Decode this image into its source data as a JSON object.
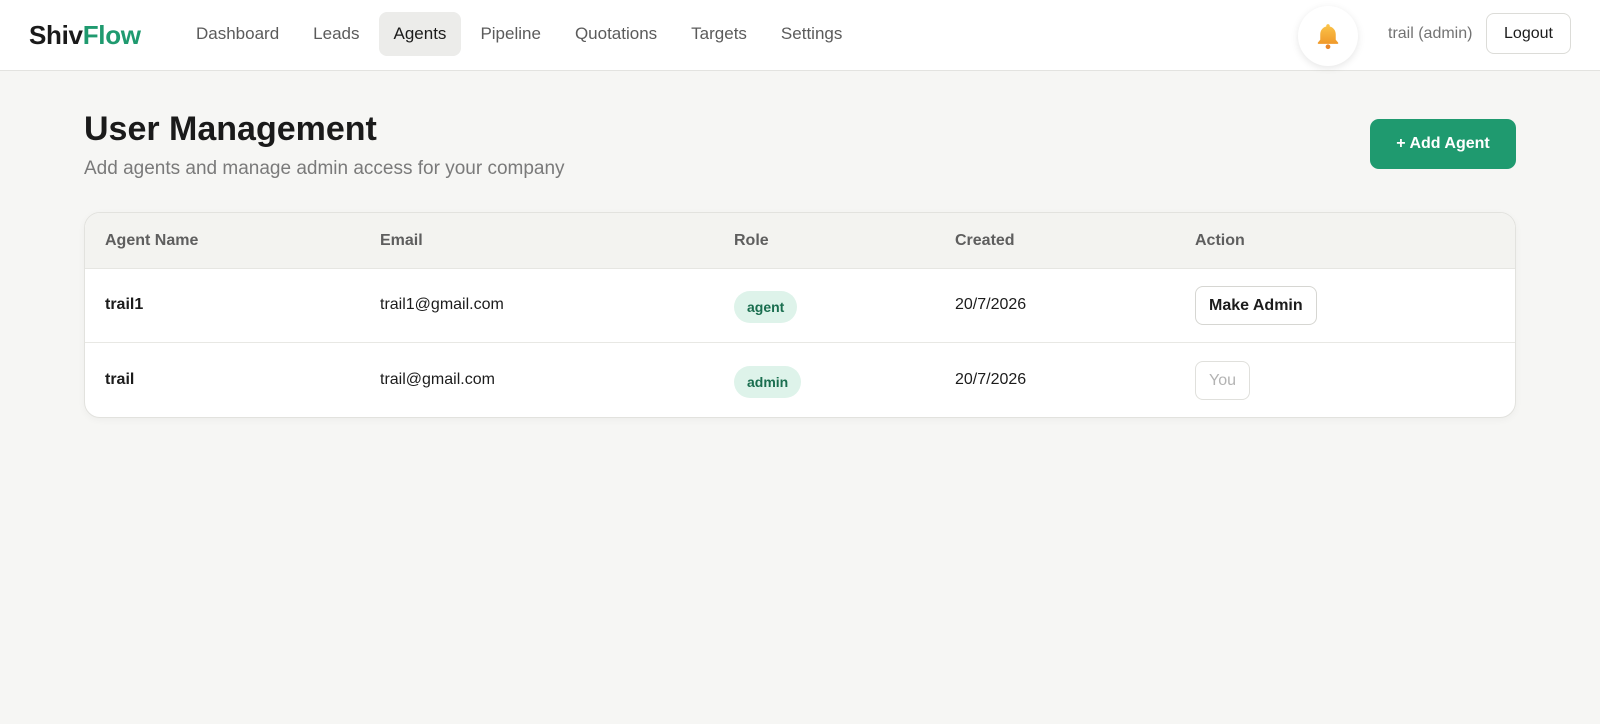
{
  "brand": {
    "part1": "Shiv",
    "part2": "Flow"
  },
  "nav": {
    "items": [
      {
        "label": "Dashboard",
        "active": false
      },
      {
        "label": "Leads",
        "active": false
      },
      {
        "label": "Agents",
        "active": true
      },
      {
        "label": "Pipeline",
        "active": false
      },
      {
        "label": "Quotations",
        "active": false
      },
      {
        "label": "Targets",
        "active": false
      },
      {
        "label": "Settings",
        "active": false
      }
    ]
  },
  "header_right": {
    "notification_icon": "bell-icon",
    "user_label": "trail (admin)",
    "logout_label": "Logout"
  },
  "page": {
    "title": "User Management",
    "subtitle": "Add agents and manage admin access for your company",
    "add_button_label": "+ Add Agent"
  },
  "table": {
    "columns": [
      "Agent Name",
      "Email",
      "Role",
      "Created",
      "Action"
    ],
    "rows": [
      {
        "name": "trail1",
        "email": "trail1@gmail.com",
        "role": "agent",
        "created": "20/7/2026",
        "action": "Make Admin",
        "action_enabled": true
      },
      {
        "name": "trail",
        "email": "trail@gmail.com",
        "role": "admin",
        "created": "20/7/2026",
        "action": "You",
        "action_enabled": false
      }
    ]
  },
  "colors": {
    "accent": "#1f9a6f",
    "badge_bg": "#def3ea",
    "badge_text": "#1a6e4f",
    "background": "#f6f6f4"
  }
}
